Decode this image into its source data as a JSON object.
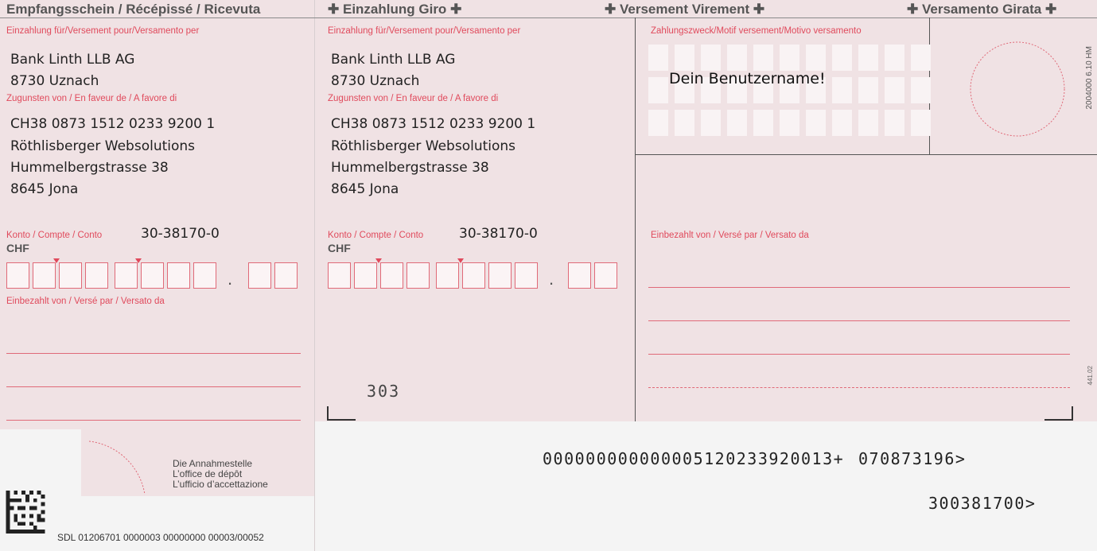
{
  "header": {
    "receipt_title": "Empfangsschein / Récépissé / Ricevuta",
    "deposit_giro": "Einzahlung Giro",
    "versement_virement": "Versement Virement",
    "versamento_girata": "Versamento Girata"
  },
  "receipt": {
    "payment_for_label": "Einzahlung für/Versement pour/Versamento per",
    "bank_name": "Bank Linth LLB AG",
    "bank_city": "8730 Uznach",
    "in_favour_label": "Zugunsten von / En faveur de / A favore di",
    "iban": "CH38 0873 1512 0233 9200 1",
    "beneficiary_name": "Röthlisberger Websolutions",
    "beneficiary_street": "Hummelbergstrasse 38",
    "beneficiary_city": "8645 Jona",
    "account_label": "Konto / Compte / Conto",
    "account_number": "30-38170-0",
    "currency": "CHF",
    "amount_decimal_point": ".",
    "paid_by_label": "Einbezahlt von / Versé par / Versato da"
  },
  "giro": {
    "payment_for_label": "Einzahlung für/Versement pour/Versamento per",
    "bank_name": "Bank Linth LLB AG",
    "bank_city": "8730 Uznach",
    "in_favour_label": "Zugunsten von / En faveur de / A favore di",
    "iban": "CH38 0873 1512 0233 9200 1",
    "beneficiary_name": "Röthlisberger Websolutions",
    "beneficiary_street": "Hummelbergstrasse 38",
    "beneficiary_city": "8645 Jona",
    "account_label": "Konto / Compte / Conto",
    "account_number": "30-38170-0",
    "currency": "CHF",
    "amount_decimal_point": ".",
    "code": "303"
  },
  "purpose": {
    "label": "Zahlungszweck/Motif versement/Motivo versamento",
    "text": "Dein Benutzername!",
    "side_code": "2004000 6.10 HM"
  },
  "paid_by": {
    "label": "Einbezahlt von / Versé par / Versato da",
    "side_code": "441.02"
  },
  "acceptance": {
    "line1": "Die Annahmestelle",
    "line2": "L’office de dépôt",
    "line3": "L’ufficio d’accettazione",
    "footer_code": "SDL 01206701 0000003 00000000 00003/00052"
  },
  "coding_line": {
    "reference": "000000000000005120233920013+",
    "clearing": "070873196>",
    "account": "300381700>"
  },
  "colors": {
    "form_pink": "#f0e2e4",
    "label_red": "#e04a5c"
  }
}
